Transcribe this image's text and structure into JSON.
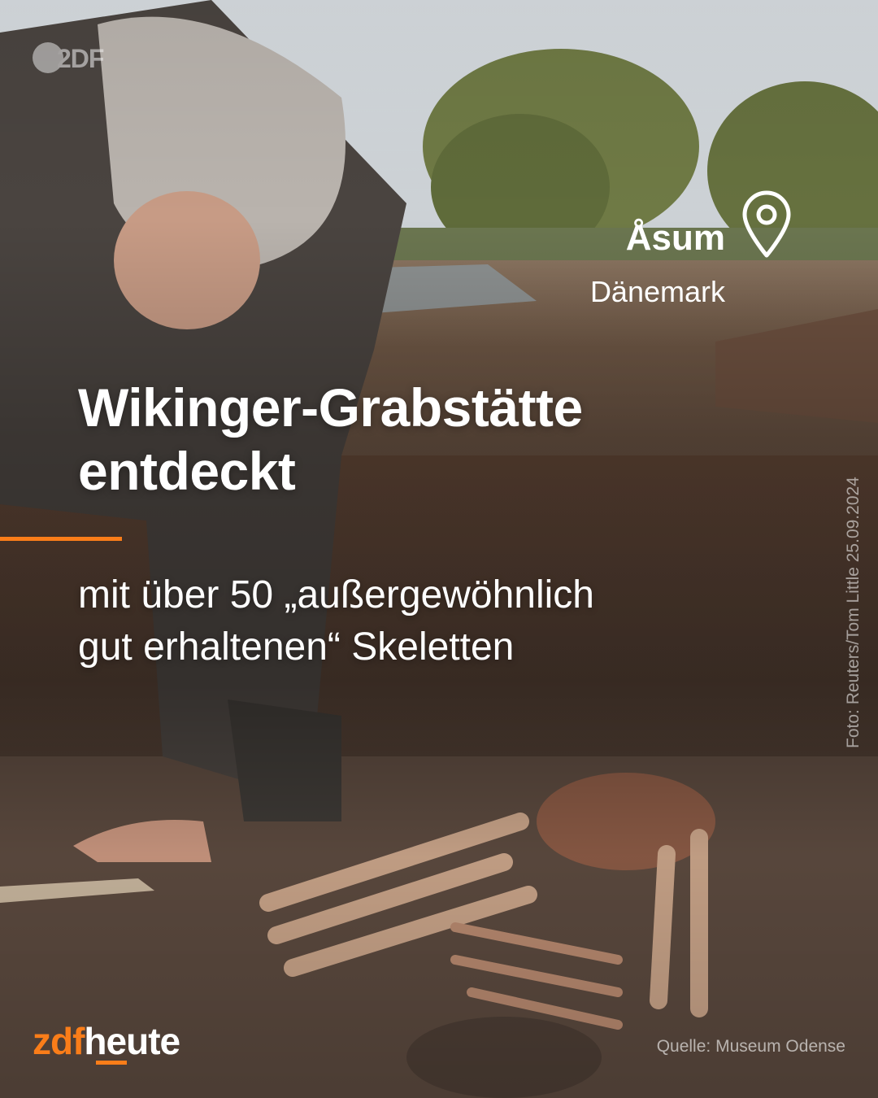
{
  "watermark": {
    "logo_text": "2DF"
  },
  "credit": "Foto: Reuters/Tom Little 25.09.2024",
  "location": {
    "name": "Åsum",
    "country": "Dänemark",
    "icon": "location-pin-icon"
  },
  "headline": {
    "line1": "Wikinger-Grabstätte",
    "line2": "entdeckt"
  },
  "subline": {
    "line1": "mit über 50 „außergewöhnlich",
    "line2": "gut erhaltenen“ Skeletten"
  },
  "brand": {
    "zdf": "zdf",
    "heute": "heute"
  },
  "source": "Quelle: Museum Odense",
  "colors": {
    "accent": "#fa7d19",
    "text": "#ffffff"
  }
}
